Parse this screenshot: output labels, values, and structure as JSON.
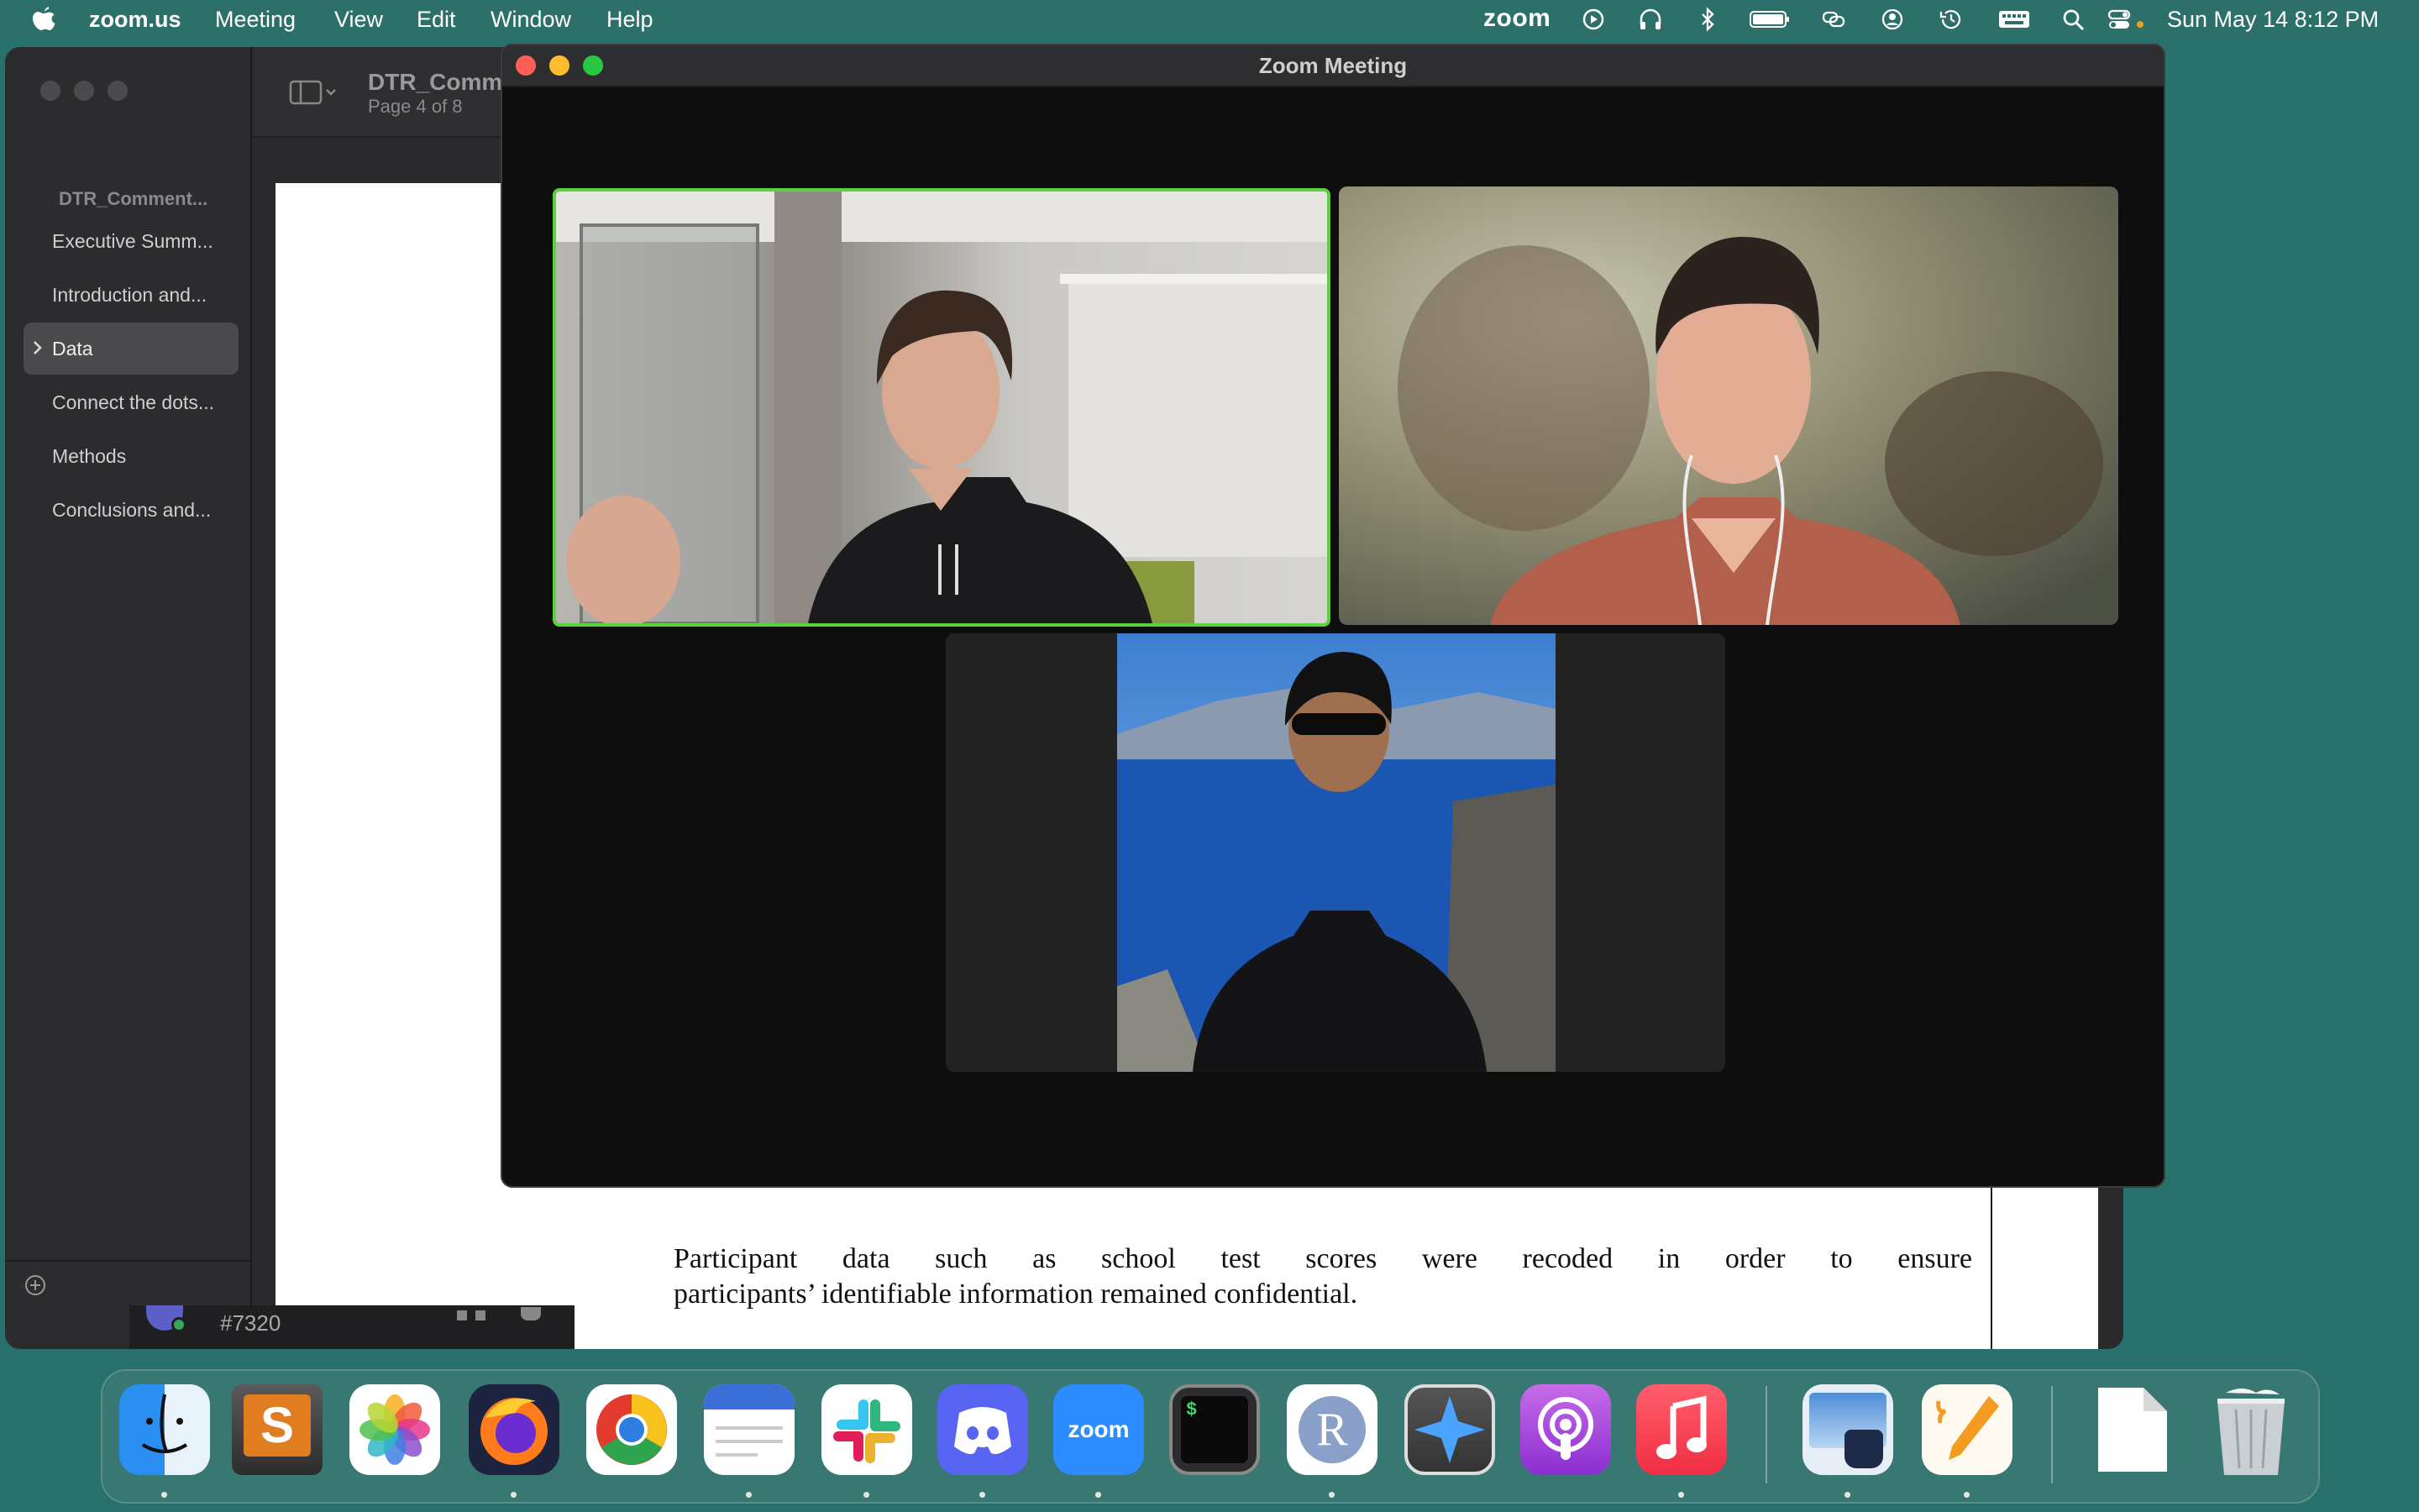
{
  "menubar": {
    "app_name": "zoom.us",
    "menus": [
      "Meeting",
      "View",
      "Edit",
      "Window",
      "Help"
    ],
    "zoom_logo": "zoom",
    "datetime": "Sun May 14  8:12 PM",
    "icons": [
      "apple-icon",
      "zoom-logo",
      "play-icon",
      "headphones-icon",
      "bluetooth-icon",
      "battery-icon",
      "screen-mirroring-icon",
      "user-icon",
      "time-machine-icon",
      "keyboard-icon",
      "search-icon",
      "control-center-icon"
    ]
  },
  "preview": {
    "doc_title": "DTR_Comme",
    "page_info": "Page 4 of 8",
    "sidebar_heading": "DTR_Comment...",
    "sidebar_items": [
      "Executive Summ...",
      "Introduction and...",
      "Data",
      "Connect the dots...",
      "Methods",
      "Conclusions and..."
    ],
    "selected_item": "Data",
    "body_line1": "Participant data such as school test scores were recoded in order to ensure",
    "body_line2": "participants’ identifiable information remained confidential.",
    "help_label": "?",
    "bottom_tag": "#7320"
  },
  "zoom": {
    "title": "Zoom Meeting"
  },
  "dock": {
    "apps": [
      "Finder",
      "Sublime Text",
      "Photos",
      "Firefox",
      "Chrome",
      "Notes",
      "Slack",
      "Discord",
      "zoom",
      "Terminal",
      "R",
      "Spark",
      "Podcasts",
      "Music",
      "Preview",
      "Pages",
      "Document",
      "Trash"
    ],
    "zoom_label": "zoom",
    "r_label": "R",
    "terminal_label": "$"
  },
  "colors": {
    "desktop": "#27706b",
    "active_speaker_border": "#5ad23e",
    "zoom_blue": "#2d8cff"
  }
}
